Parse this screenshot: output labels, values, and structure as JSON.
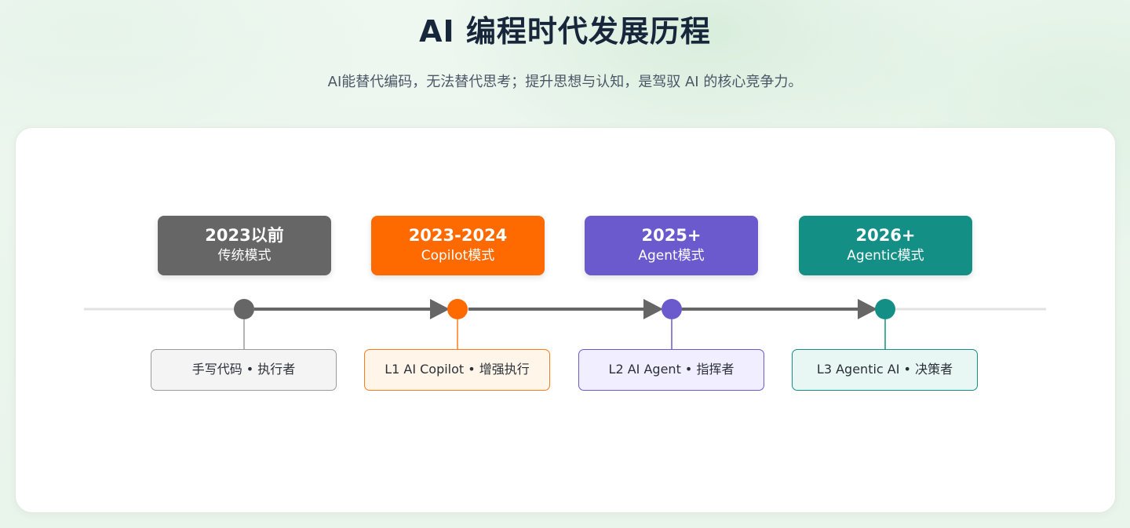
{
  "title": "AI 编程时代发展历程",
  "subtitle": "AI能替代编码，无法替代思考；提升思想与认知，是驾驭 AI 的核心竞争力。",
  "stages": [
    {
      "year": "2023以前",
      "mode": "传统模式",
      "role": "手写代码 • 执行者",
      "color": "#666666",
      "role_bg": "#f4f4f4",
      "role_border": "#9a9a9a"
    },
    {
      "year": "2023-2024",
      "mode": "Copilot模式",
      "role": "L1 AI Copilot • 增强执行",
      "color": "#ff6a00",
      "role_bg": "#fff5e8",
      "role_border": "#ff7a1a"
    },
    {
      "year": "2025+",
      "mode": "Agent模式",
      "role": "L2 AI Agent • 指挥者",
      "color": "#6a5acd",
      "role_bg": "#f1efff",
      "role_border": "#6a5acd"
    },
    {
      "year": "2026+",
      "mode": "Agentic模式",
      "role": "L3 Agentic AI • 决策者",
      "color": "#138f86",
      "role_bg": "#e8f7f4",
      "role_border": "#138f86"
    }
  ],
  "colors": {
    "axis": "#e2e2e2",
    "arrow": "#666666"
  }
}
